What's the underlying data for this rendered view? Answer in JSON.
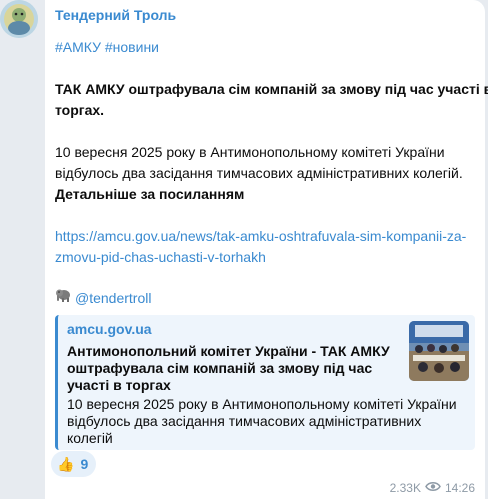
{
  "channel": {
    "name": "Тендерний Троль"
  },
  "message": {
    "hashtags": "#АМКУ #новини",
    "headline_lines": [
      "ТАК АМКУ оштрафувала сім компаній за змову під час участі в",
      "торгах."
    ],
    "body_lines": [
      "10 вересня 2025 року в Антимонопольному комітеті України",
      "відбулось два засідання тимчасових адміністративних колегій."
    ],
    "details": "Детальніше за посиланням",
    "link_lines": [
      "https://amcu.gov.ua/news/tak-amku-oshtrafuvala-sim-kompanii-za-",
      "zmovu-pid-chas-uchasti-v-torhakh"
    ],
    "signature": "@tendertroll"
  },
  "preview": {
    "site": "amcu.gov.ua",
    "title_lines": [
      "Антимонопольний комітет України - ТАК АМКУ",
      "оштрафувала сім компаній за змову під час",
      "участі в торгах"
    ],
    "desc_lines": [
      "10 вересня 2025 року в Антимонопольному комітеті України",
      "відбулось два засідання тимчасових адміністративних",
      "колегій"
    ]
  },
  "reaction": {
    "emoji": "👍",
    "count": "9"
  },
  "meta": {
    "views": "2.33K",
    "time": "14:26"
  }
}
